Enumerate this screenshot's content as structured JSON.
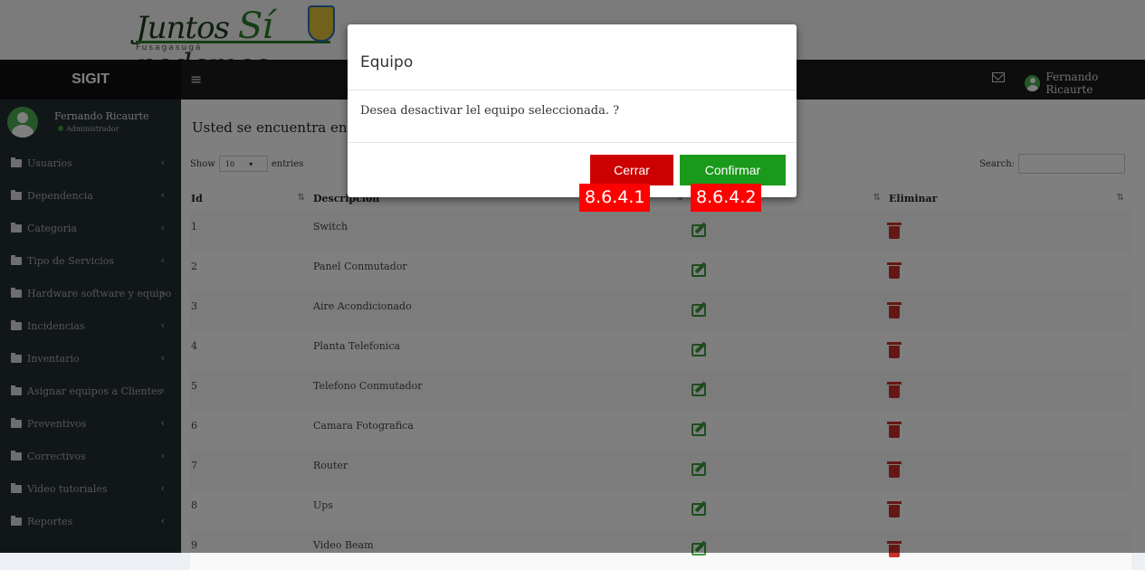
{
  "banner": {
    "logo_main": "Juntos",
    "logo_si": "Sí",
    "logo_end": "podemos",
    "logo_sub": "Fusagasugá"
  },
  "navbar": {
    "brand": "SIGIT",
    "menu_toggle": "≡",
    "user_name": "Fernando Ricaurte"
  },
  "sidebar": {
    "user_name": "Fernando Ricaurte",
    "user_role": "Administrador",
    "chevron": "‹",
    "items": [
      {
        "label": "Usuarios"
      },
      {
        "label": "Dependencia"
      },
      {
        "label": "Categoria"
      },
      {
        "label": "Tipo de Servicios"
      },
      {
        "label": "Hardware software y equipo"
      },
      {
        "label": "Incidencias"
      },
      {
        "label": "Inventario"
      },
      {
        "label": "Asignar equipos a Clientes"
      },
      {
        "label": "Preventivos"
      },
      {
        "label": "Correctivos"
      },
      {
        "label": "Video tutoriales"
      },
      {
        "label": "Reportes"
      }
    ]
  },
  "content": {
    "breadcrumb": "Usted se encuentra en :",
    "breadcrumb_sep": ">",
    "show_label": "Show",
    "entries_value": "10",
    "entries_label": "entries",
    "search_label": "Search:",
    "columns": [
      "Id",
      "Descripcion",
      "",
      "Eliminar"
    ],
    "rows": [
      {
        "id": "1",
        "desc": "Switch"
      },
      {
        "id": "2",
        "desc": "Panel Conmutador"
      },
      {
        "id": "3",
        "desc": "Aire Acondicionado"
      },
      {
        "id": "4",
        "desc": "Planta Telefonica"
      },
      {
        "id": "5",
        "desc": "Telefono Conmutador"
      },
      {
        "id": "6",
        "desc": "Camara Fotografica"
      },
      {
        "id": "7",
        "desc": "Router"
      },
      {
        "id": "8",
        "desc": "Ups"
      },
      {
        "id": "9",
        "desc": "Video Beam"
      }
    ]
  },
  "modal": {
    "title": "Equipo",
    "body": "Desea desactivar lel equipo seleccionada. ?",
    "cancel_label": "Cerrar",
    "confirm_label": "Confirmar"
  },
  "annotations": {
    "tag1": "8.6.4.1",
    "tag2": "8.6.4.2"
  },
  "colors": {
    "cancel": "#cc0000",
    "confirm": "#1a9a1a",
    "tag": "#ff0000",
    "sidebar": "#222d32"
  }
}
